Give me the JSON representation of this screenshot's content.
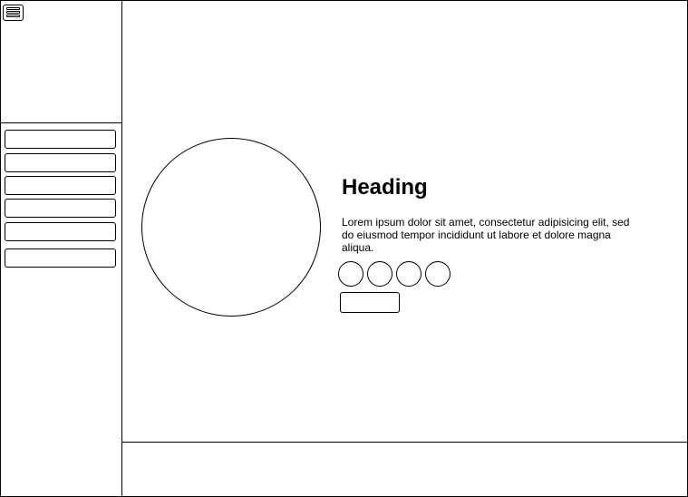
{
  "content": {
    "heading": "Heading",
    "body": "Lorem ipsum dolor sit amet, consectetur adipisicing elit, sed do eiusmod tempor incididunt ut labore et dolore magna aliqua."
  },
  "sidebar": {
    "menu_icon": "hamburger-menu-icon",
    "nav_items": [
      "",
      "",
      "",
      "",
      "",
      ""
    ]
  },
  "social_icons": [
    "social-icon-1",
    "social-icon-2",
    "social-icon-3",
    "social-icon-4"
  ]
}
